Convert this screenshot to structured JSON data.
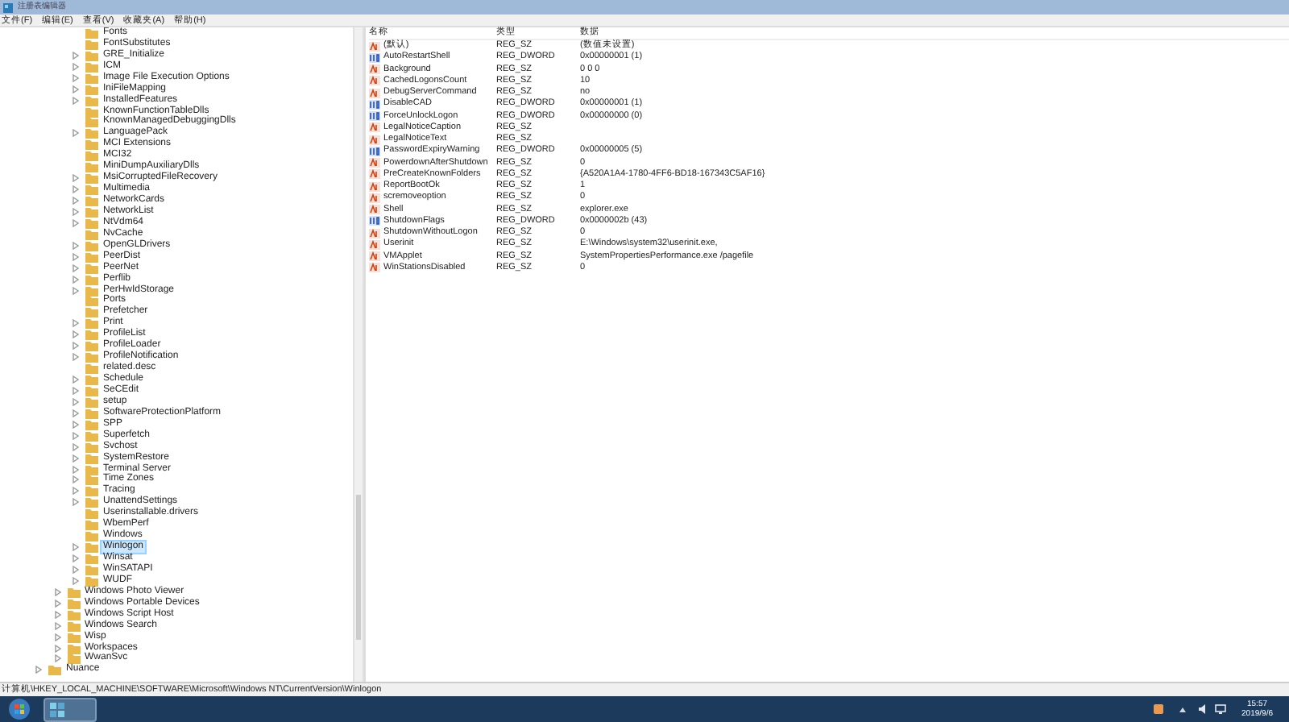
{
  "window": {
    "title": "注册表编辑器"
  },
  "menu": [
    "文件(F)",
    "编辑(E)",
    "查看(V)",
    "收藏夹(A)",
    "帮助(H)"
  ],
  "tree": {
    "items": [
      {
        "children": [
          {
            "children": [
              {
                "label": "Fonts",
                "expandable": false,
                "selected": false
              },
              {
                "label": "FontSubstitutes",
                "expandable": false,
                "selected": false
              },
              {
                "label": "GRE_Initialize",
                "expandable": true,
                "selected": false
              },
              {
                "label": "ICM",
                "expandable": true,
                "selected": false
              },
              {
                "label": "Image File Execution Options",
                "expandable": true,
                "selected": false
              },
              {
                "label": "IniFileMapping",
                "expandable": true,
                "selected": false
              },
              {
                "label": "InstalledFeatures",
                "expandable": true,
                "selected": false
              },
              {
                "label": "KnownFunctionTableDlls",
                "expandable": false,
                "selected": false
              },
              {
                "label": "KnownManagedDebuggingDlls",
                "expandable": false,
                "selected": false
              },
              {
                "label": "LanguagePack",
                "expandable": true,
                "selected": false
              },
              {
                "label": "MCI Extensions",
                "expandable": false,
                "selected": false
              },
              {
                "label": "MCI32",
                "expandable": false,
                "selected": false
              },
              {
                "label": "MiniDumpAuxiliaryDlls",
                "expandable": false,
                "selected": false
              },
              {
                "label": "MsiCorruptedFileRecovery",
                "expandable": true,
                "selected": false
              },
              {
                "label": "Multimedia",
                "expandable": true,
                "selected": false
              },
              {
                "label": "NetworkCards",
                "expandable": true,
                "selected": false
              },
              {
                "label": "NetworkList",
                "expandable": true,
                "selected": false
              },
              {
                "label": "NtVdm64",
                "expandable": true,
                "selected": false
              },
              {
                "label": "NvCache",
                "expandable": false,
                "selected": false
              },
              {
                "label": "OpenGLDrivers",
                "expandable": true,
                "selected": false
              },
              {
                "label": "PeerDist",
                "expandable": true,
                "selected": false
              },
              {
                "label": "PeerNet",
                "expandable": true,
                "selected": false
              },
              {
                "label": "Perflib",
                "expandable": true,
                "selected": false
              },
              {
                "label": "PerHwIdStorage",
                "expandable": true,
                "selected": false
              },
              {
                "label": "Ports",
                "expandable": false,
                "selected": false
              },
              {
                "label": "Prefetcher",
                "expandable": false,
                "selected": false
              },
              {
                "label": "Print",
                "expandable": true,
                "selected": false
              },
              {
                "label": "ProfileList",
                "expandable": true,
                "selected": false
              },
              {
                "label": "ProfileLoader",
                "expandable": true,
                "selected": false
              },
              {
                "label": "ProfileNotification",
                "expandable": true,
                "selected": false
              },
              {
                "label": "related.desc",
                "expandable": false,
                "selected": false
              },
              {
                "label": "Schedule",
                "expandable": true,
                "selected": false
              },
              {
                "label": "SeCEdit",
                "expandable": true,
                "selected": false
              },
              {
                "label": "setup",
                "expandable": true,
                "selected": false
              },
              {
                "label": "SoftwareProtectionPlatform",
                "expandable": true,
                "selected": false
              },
              {
                "label": "SPP",
                "expandable": true,
                "selected": false
              },
              {
                "label": "Superfetch",
                "expandable": true,
                "selected": false
              },
              {
                "label": "Svchost",
                "expandable": true,
                "selected": false
              },
              {
                "label": "SystemRestore",
                "expandable": true,
                "selected": false
              },
              {
                "label": "Terminal Server",
                "expandable": true,
                "selected": false
              },
              {
                "label": "Time Zones",
                "expandable": true,
                "selected": false
              },
              {
                "label": "Tracing",
                "expandable": true,
                "selected": false
              },
              {
                "label": "UnattendSettings",
                "expandable": true,
                "selected": false
              },
              {
                "label": "Userinstallable.drivers",
                "expandable": false,
                "selected": false
              },
              {
                "label": "WbemPerf",
                "expandable": false,
                "selected": false
              },
              {
                "label": "Windows",
                "expandable": false,
                "selected": false
              },
              {
                "label": "Winlogon",
                "expandable": true,
                "selected": true
              },
              {
                "label": "Winsat",
                "expandable": true,
                "selected": false
              },
              {
                "label": "WinSATAPI",
                "expandable": true,
                "selected": false
              },
              {
                "label": "WUDF",
                "expandable": true,
                "selected": false
              }
            ]
          },
          {
            "label": "Windows Photo Viewer",
            "expandable": true,
            "selected": false
          },
          {
            "label": "Windows Portable Devices",
            "expandable": true,
            "selected": false
          },
          {
            "label": "Windows Script Host",
            "expandable": true,
            "selected": false
          },
          {
            "label": "Windows Search",
            "expandable": true,
            "selected": false
          },
          {
            "label": "Wisp",
            "expandable": true,
            "selected": false
          },
          {
            "label": "Workspaces",
            "expandable": true,
            "selected": false
          },
          {
            "label": "WwanSvc",
            "expandable": true,
            "selected": false
          }
        ]
      },
      {
        "label": "Nuance",
        "expandable": true,
        "selected": false
      }
    ]
  },
  "table": {
    "columns": [
      "名称",
      "类型",
      "数据"
    ],
    "rows": [
      {
        "kind": "string",
        "name": "(默认)",
        "type": "REG_SZ",
        "data": "(数值未设置)"
      },
      {
        "kind": "binary",
        "name": "AutoRestartShell",
        "type": "REG_DWORD",
        "data": "0x00000001 (1)"
      },
      {
        "kind": "string",
        "name": "Background",
        "type": "REG_SZ",
        "data": "0 0 0"
      },
      {
        "kind": "string",
        "name": "CachedLogonsCount",
        "type": "REG_SZ",
        "data": "10"
      },
      {
        "kind": "string",
        "name": "DebugServerCommand",
        "type": "REG_SZ",
        "data": "no"
      },
      {
        "kind": "binary",
        "name": "DisableCAD",
        "type": "REG_DWORD",
        "data": "0x00000001 (1)"
      },
      {
        "kind": "binary",
        "name": "ForceUnlockLogon",
        "type": "REG_DWORD",
        "data": "0x00000000 (0)"
      },
      {
        "kind": "string",
        "name": "LegalNoticeCaption",
        "type": "REG_SZ"
      },
      {
        "kind": "string",
        "name": "LegalNoticeText",
        "type": "REG_SZ"
      },
      {
        "kind": "binary",
        "name": "PasswordExpiryWarning",
        "type": "REG_DWORD",
        "data": "0x00000005 (5)"
      },
      {
        "kind": "string",
        "name": "PowerdownAfterShutdown",
        "type": "REG_SZ",
        "data": "0"
      },
      {
        "kind": "string",
        "name": "PreCreateKnownFolders",
        "type": "REG_SZ",
        "data": "{A520A1A4-1780-4FF6-BD18-167343C5AF16}"
      },
      {
        "kind": "string",
        "name": "ReportBootOk",
        "type": "REG_SZ",
        "data": "1"
      },
      {
        "kind": "string",
        "name": "scremoveoption",
        "type": "REG_SZ",
        "data": "0"
      },
      {
        "kind": "string",
        "name": "Shell",
        "type": "REG_SZ",
        "data": "explorer.exe"
      },
      {
        "kind": "binary",
        "name": "ShutdownFlags",
        "type": "REG_DWORD",
        "data": "0x0000002b (43)"
      },
      {
        "kind": "string",
        "name": "ShutdownWithoutLogon",
        "type": "REG_SZ",
        "data": "0"
      },
      {
        "kind": "string",
        "name": "Userinit",
        "type": "REG_SZ",
        "data": "E:\\Windows\\system32\\userinit.exe,"
      },
      {
        "kind": "string",
        "name": "VMApplet",
        "type": "REG_SZ",
        "data": "SystemPropertiesPerformance.exe /pagefile"
      },
      {
        "kind": "string",
        "name": "WinStationsDisabled",
        "type": "REG_SZ",
        "data": "0"
      }
    ]
  },
  "status_bar": "计算机\\HKEY_LOCAL_MACHINE\\SOFTWARE\\Microsoft\\Windows NT\\CurrentVersion\\Winlogon",
  "taskbar": {
    "time": "15:57",
    "date": "2019/9/6"
  }
}
